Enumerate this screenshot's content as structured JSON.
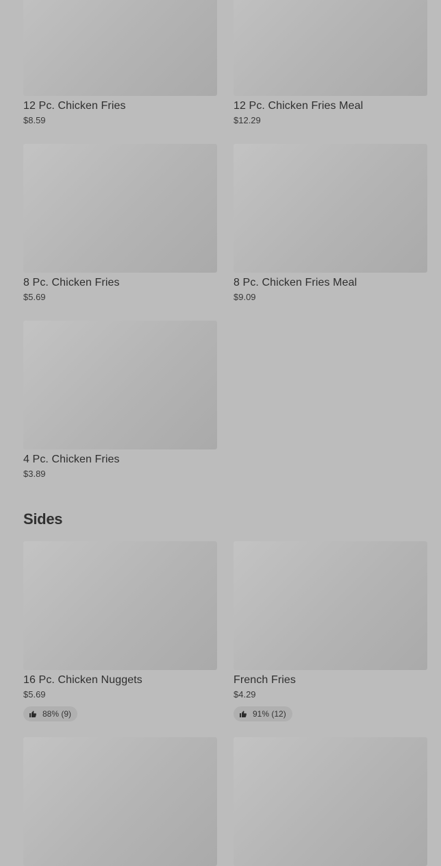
{
  "chicken_fries": {
    "items": [
      {
        "name": "12 Pc. Chicken Fries",
        "price": "$8.59"
      },
      {
        "name": "12 Pc. Chicken Fries Meal",
        "price": "$12.29"
      },
      {
        "name": "8 Pc. Chicken Fries",
        "price": "$5.69"
      },
      {
        "name": "8 Pc. Chicken Fries Meal",
        "price": "$9.09"
      },
      {
        "name": "4 Pc. Chicken Fries",
        "price": "$3.89"
      }
    ]
  },
  "sides": {
    "title": "Sides",
    "items": [
      {
        "name": "16 Pc. Chicken Nuggets",
        "price": "$5.69",
        "rating": "88% (9)",
        "rating_icon": "thumbs-up-icon"
      },
      {
        "name": "French Fries",
        "price": "$4.29",
        "rating": "91% (12)",
        "rating_icon": "thumbs-up-icon"
      },
      {
        "name": "",
        "price": ""
      },
      {
        "name": "",
        "price": ""
      }
    ]
  },
  "colors": {
    "background": "#bcbcbc",
    "placeholder": "#b4b4b4",
    "text": "#2e2e2e",
    "rating_pill": "#b0b0b0"
  }
}
